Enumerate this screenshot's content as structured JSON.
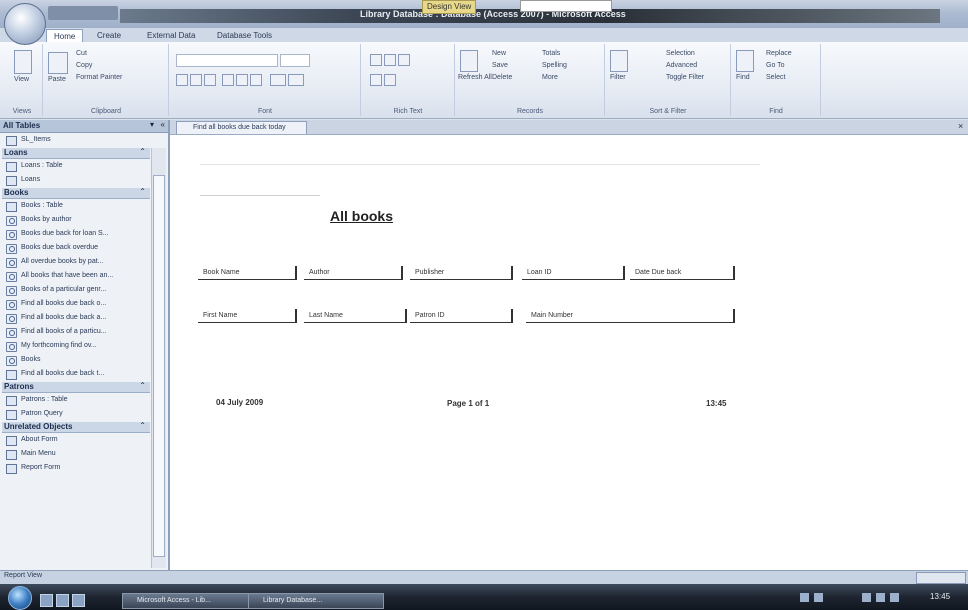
{
  "window": {
    "title": "Library Database : Database (Access 2007) - Microsoft Access",
    "context_tab": "Design View",
    "qat_label": "",
    "office_button": "office-button"
  },
  "ribbon": {
    "tabs": [
      "Home",
      "Create",
      "External Data",
      "Database Tools"
    ],
    "active_tab": "Home",
    "groups": [
      {
        "label": "Views",
        "items": [
          "View"
        ]
      },
      {
        "label": "Clipboard",
        "items": [
          "Cut",
          "Copy",
          "Format Painter",
          "Paste"
        ]
      },
      {
        "label": "Font",
        "items": []
      },
      {
        "label": "Rich Text",
        "items": []
      },
      {
        "label": "Records",
        "items": [
          "Refresh All",
          "New",
          "Save",
          "Delete",
          "Totals",
          "Spelling",
          "More"
        ]
      },
      {
        "label": "Sort & Filter",
        "items": [
          "Filter",
          "Selection",
          "Advanced",
          "Toggle Filter"
        ]
      },
      {
        "label": "Find",
        "items": [
          "Find",
          "Replace",
          "Go To",
          "Select"
        ]
      }
    ]
  },
  "nav_pane": {
    "header": "All Tables",
    "sections": [
      {
        "title": "",
        "items": [
          {
            "label": "SL_Items",
            "kind": "table"
          }
        ]
      },
      {
        "title": "Loans",
        "items": [
          {
            "label": "Loans : Table",
            "kind": "table"
          },
          {
            "label": "Loans",
            "kind": "table"
          }
        ]
      },
      {
        "title": "Books",
        "items": [
          {
            "label": "Books : Table",
            "kind": "table"
          },
          {
            "label": "Books by author",
            "kind": "query"
          },
          {
            "label": "Books due back for loan S...",
            "kind": "query"
          },
          {
            "label": "Books due back overdue",
            "kind": "query"
          },
          {
            "label": "All overdue books by pat...",
            "kind": "query"
          },
          {
            "label": "All books that have been an...",
            "kind": "query"
          },
          {
            "label": "Books of a particular genr...",
            "kind": "query"
          },
          {
            "label": "Find all books due back o...",
            "kind": "query"
          },
          {
            "label": "Find all books due back a...",
            "kind": "query"
          },
          {
            "label": "Find all books of a particu...",
            "kind": "query"
          },
          {
            "label": "My forthcoming find ov...",
            "kind": "query"
          },
          {
            "label": "Books",
            "kind": "query"
          },
          {
            "label": "Find all books due back t...",
            "kind": "report"
          }
        ]
      },
      {
        "title": "Patrons",
        "items": [
          {
            "label": "Patrons : Table",
            "kind": "table"
          },
          {
            "label": "Patron Query",
            "kind": "table"
          }
        ]
      },
      {
        "title": "Unrelated Objects",
        "items": [
          {
            "label": "About Form",
            "kind": "table"
          },
          {
            "label": "Main Menu",
            "kind": "table"
          },
          {
            "label": "Report Form",
            "kind": "table"
          }
        ]
      }
    ]
  },
  "document": {
    "tab_label": "Find all books due back today",
    "report": {
      "title": "All books",
      "row1": [
        "Book Name",
        "Author",
        "Publisher",
        "Loan ID",
        "Date Due back"
      ],
      "row2": [
        "First Name",
        "Last Name",
        "Patron ID",
        "Main Number"
      ],
      "footer_left": "04 July 2009",
      "footer_center": "Page 1 of 1",
      "footer_right": "13:45"
    }
  },
  "status_bar": {
    "text": "Report View"
  },
  "taskbar": {
    "buttons": [
      "Microsoft Access - Lib...",
      "Library Database..."
    ],
    "clock": "13:45"
  }
}
